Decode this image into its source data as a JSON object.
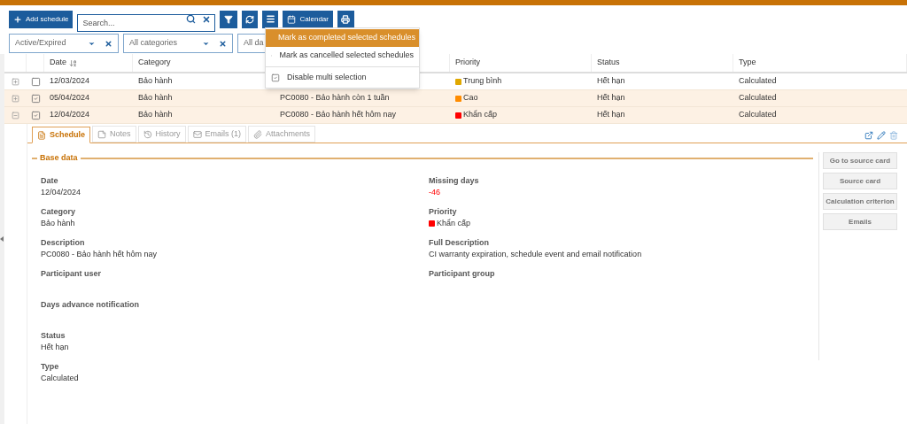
{
  "toolbar": {
    "add_button": "Add schedule",
    "search": {
      "placeholder": "Search..."
    },
    "calendar_button": "Calendar"
  },
  "filters": [
    {
      "value": "Active/Expired",
      "clearable": true
    },
    {
      "value": "All categories",
      "clearable": true
    },
    {
      "value": "All da",
      "clearable": false
    }
  ],
  "menu": {
    "items": [
      {
        "kind": "action",
        "label": "Mark as completed selected schedules",
        "selected": true
      },
      {
        "kind": "action",
        "label": "Mark as cancelled selected schedules",
        "selected": false
      },
      {
        "kind": "check",
        "label": "Disable multi selection",
        "checked": true,
        "selected": false
      }
    ]
  },
  "table": {
    "columns": [
      "Date",
      "Category",
      "Priority",
      "Status",
      "Type"
    ],
    "rows": [
      {
        "expanded": false,
        "checked": false,
        "date": "12/03/2024",
        "category": "Bảo hành",
        "priority": "Trung bình",
        "color": "#e0a800",
        "status": "Hết hạn",
        "type": "Calculated"
      },
      {
        "expanded": false,
        "checked": true,
        "date": "05/04/2024",
        "category": "Bảo hành",
        "description": "PC0080 - Bảo hành còn 1 tuần",
        "priority": "Cao",
        "color": "#ff8c00",
        "status": "Hết hạn",
        "type": "Calculated"
      },
      {
        "expanded": true,
        "checked": true,
        "date": "12/04/2024",
        "category": "Bảo hành",
        "description": "PC0080 - Bảo hành hết hôm nay",
        "priority": "Khẩn cấp",
        "color": "#ff0000",
        "status": "Hết hạn",
        "type": "Calculated"
      }
    ]
  },
  "detail": {
    "tabs": [
      {
        "label": "Schedule",
        "selected": true
      },
      {
        "label": "Notes",
        "selected": false
      },
      {
        "label": "History",
        "selected": false
      },
      {
        "label": "Emails (1)",
        "selected": false
      },
      {
        "label": "Attachments",
        "selected": false
      }
    ],
    "section": "Base data",
    "left_fields": [
      {
        "label": "Date",
        "kind": "plain",
        "value": "12/04/2024"
      },
      {
        "label": "Category",
        "kind": "plain",
        "value": "Bảo hành"
      },
      {
        "label": "Description",
        "kind": "plain",
        "value": "PC0080 - Bảo hành hết hôm nay"
      },
      {
        "label": "Participant user",
        "kind": "empty"
      },
      {
        "label": "Days advance notification",
        "kind": "empty"
      },
      {
        "label": "Status",
        "kind": "plain",
        "value": "Hết hạn"
      },
      {
        "label": "Type",
        "kind": "plain",
        "value": "Calculated"
      }
    ],
    "right_fields": [
      {
        "label": "Missing days",
        "kind": "danger",
        "value": "-46"
      },
      {
        "label": "Priority",
        "kind": "priority",
        "value": "Khẩn cấp",
        "color": "#ff0000"
      },
      {
        "label": "Full Description",
        "kind": "plain",
        "value": "CI warranty expiration, schedule event and email notification"
      },
      {
        "label": "Participant group",
        "kind": "empty"
      }
    ],
    "buttons": [
      "Go to source card",
      "Source card",
      "Calculation criterion",
      "Emails"
    ]
  }
}
